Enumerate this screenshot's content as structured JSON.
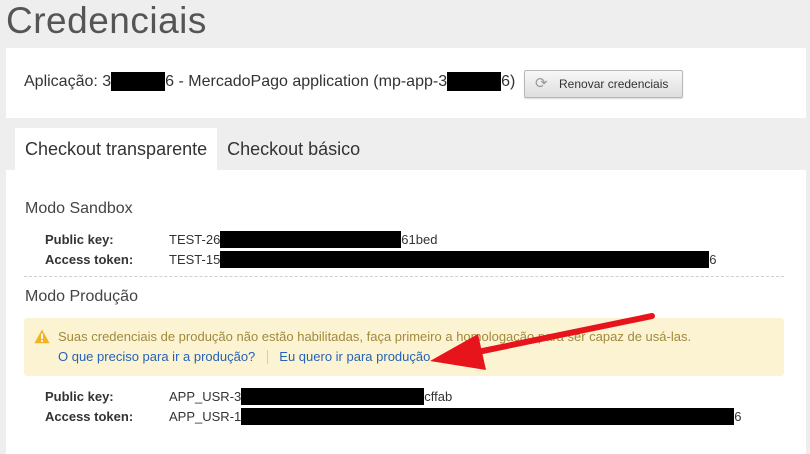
{
  "page": {
    "title": "Credenciais"
  },
  "application": {
    "prefix": "Aplicação: 3",
    "mid": "6 - MercadoPago application (mp-app-3",
    "suffix": "6)",
    "renew_label": "Renovar credenciais",
    "renew_icon": "refresh-icon"
  },
  "tabs": [
    {
      "label": "Checkout transparente",
      "active": true
    },
    {
      "label": "Checkout básico",
      "active": false
    }
  ],
  "sandbox": {
    "title": "Modo Sandbox",
    "public_key_label": "Public key:",
    "public_key_prefix": "TEST-26",
    "public_key_suffix": "61bed",
    "access_token_label": "Access token:",
    "access_token_prefix": "TEST-15",
    "access_token_suffix": "6"
  },
  "production": {
    "title": "Modo Produção",
    "alert_message": "Suas credenciais de produção não estão habilitadas, faça primeiro a homologação para ser capaz de usá-las.",
    "link_help": "O que preciso para ir a produção?",
    "link_go": "Eu quero ir para produção",
    "public_key_label": "Public key:",
    "public_key_prefix": "APP_USR-3",
    "public_key_suffix": "cffab",
    "access_token_label": "Access token:",
    "access_token_prefix": "APP_USR-1",
    "access_token_suffix": "6"
  },
  "colors": {
    "alert_bg": "#fcf3d3",
    "warning_icon": "#f0b323",
    "link": "#2563b5",
    "arrow": "#e8141b"
  }
}
